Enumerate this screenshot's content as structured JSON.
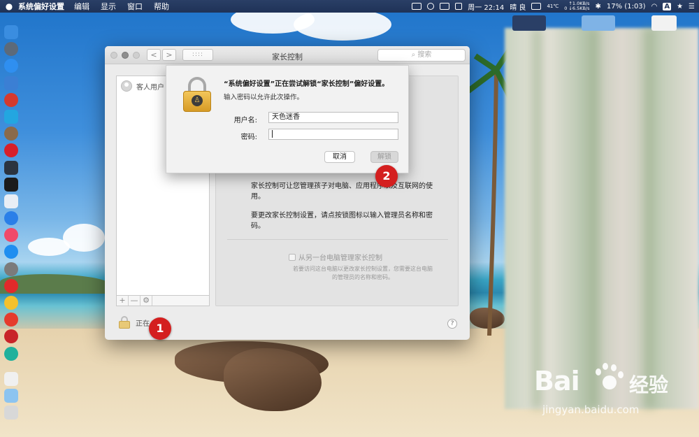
{
  "menubar": {
    "apple": "",
    "app_name": "系统偏好设置",
    "menus": [
      "编辑",
      "显示",
      "窗口",
      "帮助"
    ],
    "clock": "周一 22:14",
    "weather": "晴 良",
    "temp": "41℃",
    "net_up": "↑1.0KB/s",
    "net_down": "0 ↓6.5KB/s",
    "battery": "17% (1:03)",
    "input": "A"
  },
  "window": {
    "title": "家长控制",
    "search_placeholder": "搜索",
    "nav_back": "<",
    "nav_forward": ">",
    "grid": "::::",
    "user_list": [
      {
        "name": "客人用户"
      }
    ],
    "tool_add": "+",
    "tool_remove": "—",
    "tool_gear": "⚙",
    "content_text_1": "家长控制可让您管理孩子对电脑、应用程序以及互联网的使用。",
    "content_text_2": "要更改家长控制设置，请点按锁图标以输入管理员名称和密码。",
    "remote_checkbox_label": "从另一台电脑管理家长控制",
    "remote_note": "若要访问这台电脑以更改家长控制设置，您需要这台电脑的管理员的名称和密码。",
    "lock_text": "正在",
    "help": "?"
  },
  "dialog": {
    "title": "“系统偏好设置”正在尝试解锁“家长控制”偏好设置。",
    "subtitle": "输入密码以允许此次操作。",
    "username_label": "用户名:",
    "username_value": "天色迷香",
    "password_label": "密码:",
    "password_value": "",
    "cancel_label": "取消",
    "unlock_label": "解锁"
  },
  "markers": {
    "first": "1",
    "second": "2"
  },
  "watermark": {
    "logo": "Bai",
    "logo2": "经验",
    "url": "jingyan.baidu.com"
  },
  "colors": {
    "marker": "#d41f1f",
    "lock_gold": "#e8b84a",
    "menubar": "#22365c"
  }
}
